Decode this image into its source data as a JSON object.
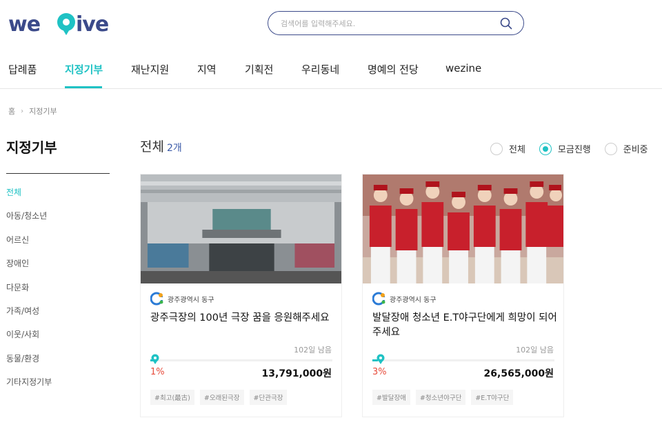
{
  "brand": {
    "logo_text": "wegive",
    "accent": "#1fc2c4",
    "navy": "#3b4a8a"
  },
  "search": {
    "placeholder": "검색어를 입력해주세요.",
    "icon": "search-icon"
  },
  "gnb": {
    "items": [
      {
        "label": "답례품",
        "active": false
      },
      {
        "label": "지정기부",
        "active": true
      },
      {
        "label": "재난지원",
        "active": false
      },
      {
        "label": "지역",
        "active": false
      },
      {
        "label": "기획전",
        "active": false
      },
      {
        "label": "우리동네",
        "active": false
      },
      {
        "label": "명예의 전당",
        "active": false
      },
      {
        "label": "wezine",
        "active": false
      }
    ]
  },
  "breadcrumb": {
    "home": "홈",
    "current": "지정기부"
  },
  "sidebar": {
    "title": "지정기부",
    "items": [
      {
        "label": "전체",
        "active": true
      },
      {
        "label": "아동/청소년"
      },
      {
        "label": "어르신"
      },
      {
        "label": "장애인"
      },
      {
        "label": "다문화"
      },
      {
        "label": "가족/여성"
      },
      {
        "label": "이웃/사회"
      },
      {
        "label": "동물/환경"
      },
      {
        "label": "기타지정기부"
      }
    ]
  },
  "list": {
    "heading": "전체",
    "count": "2개"
  },
  "filters": [
    {
      "label": "전체",
      "checked": false
    },
    {
      "label": "모금진행",
      "checked": true
    },
    {
      "label": "준비중",
      "checked": false
    }
  ],
  "cards": [
    {
      "org": "광주광역시 동구",
      "title": "광주극장의 100년 극장 꿈을 응원해주세요",
      "days_left": "102일 남음",
      "percent_label": "1%",
      "progress": 0.01,
      "amount": "13,791,000원",
      "tags": [
        "#최고(最古)",
        "#오래된극장",
        "#단관극장"
      ]
    },
    {
      "org": "광주광역시 동구",
      "title": "발달장애 청소년 E.T야구단에게 희망이 되어주세요",
      "days_left": "102일 남음",
      "percent_label": "3%",
      "progress": 0.03,
      "amount": "26,565,000원",
      "tags": [
        "#발달장애",
        "#청소년야구단",
        "#E.T야구단"
      ]
    }
  ]
}
